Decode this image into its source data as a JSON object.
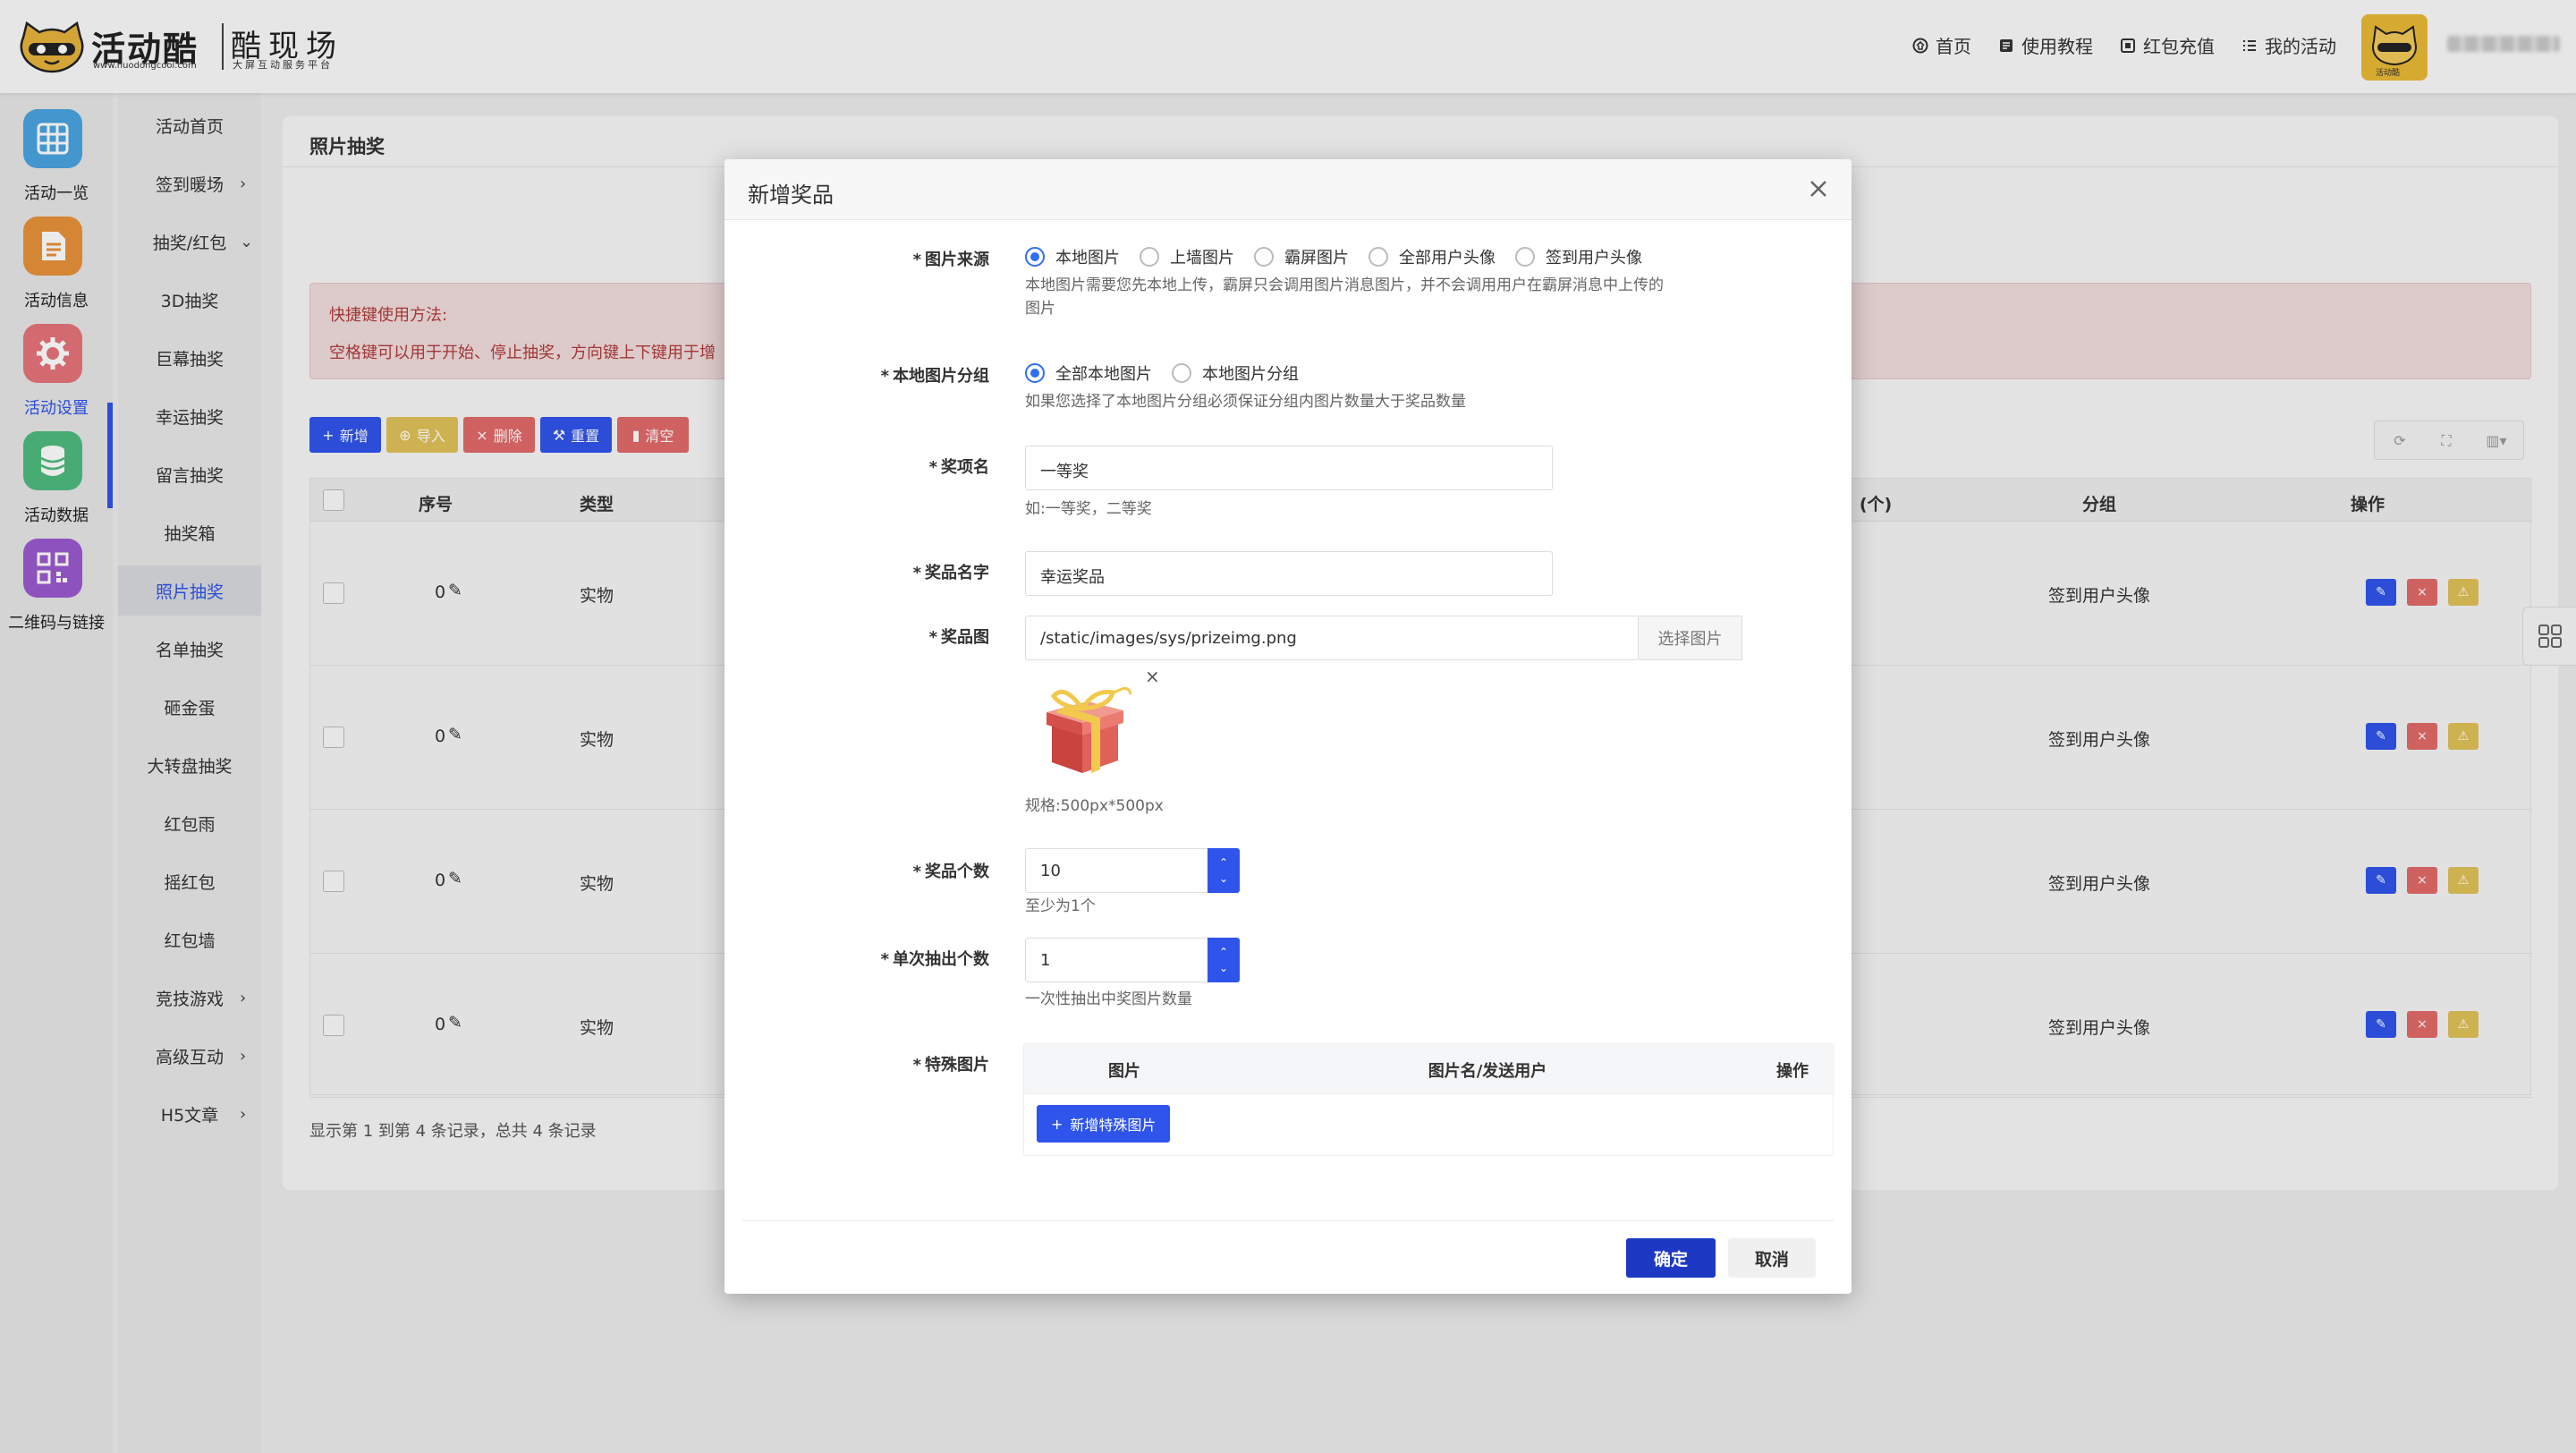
{
  "header": {
    "brand": "活动酷",
    "brand_url": "www.huodongcool.com",
    "brand_cool": "酷现场",
    "brand_tagline": "大屏互动服务平台",
    "nav": [
      {
        "label": "首页",
        "icon": "home-icon"
      },
      {
        "label": "使用教程",
        "icon": "book-icon"
      },
      {
        "label": "红包充值",
        "icon": "wallet-icon"
      },
      {
        "label": "我的活动",
        "icon": "list-icon"
      }
    ],
    "avatar_text": "活动酷"
  },
  "rail": {
    "items": [
      {
        "label": "活动一览",
        "icon": "grid-icon",
        "color": "#4aa3e0"
      },
      {
        "label": "活动信息",
        "icon": "document-icon",
        "color": "#e8923a"
      },
      {
        "label": "活动设置",
        "icon": "gear-icon",
        "color": "#e5737a"
      },
      {
        "label": "活动数据",
        "icon": "database-icon",
        "color": "#4fba7e"
      },
      {
        "label": "二维码与链接",
        "icon": "qrcode-icon",
        "color": "#9b59d0"
      }
    ]
  },
  "submenu": {
    "items": [
      {
        "label": "活动首页",
        "arrow": ""
      },
      {
        "label": "签到暖场",
        "arrow": "›"
      },
      {
        "label": "抽奖/红包",
        "arrow": "⌄"
      },
      {
        "label": "3D抽奖",
        "arrow": ""
      },
      {
        "label": "巨幕抽奖",
        "arrow": ""
      },
      {
        "label": "幸运抽奖",
        "arrow": ""
      },
      {
        "label": "留言抽奖",
        "arrow": ""
      },
      {
        "label": "抽奖箱",
        "arrow": ""
      },
      {
        "label": "照片抽奖",
        "arrow": ""
      },
      {
        "label": "名单抽奖",
        "arrow": ""
      },
      {
        "label": "砸金蛋",
        "arrow": ""
      },
      {
        "label": "大转盘抽奖",
        "arrow": ""
      },
      {
        "label": "红包雨",
        "arrow": ""
      },
      {
        "label": "摇红包",
        "arrow": ""
      },
      {
        "label": "红包墙",
        "arrow": ""
      },
      {
        "label": "竞技游戏",
        "arrow": "›"
      },
      {
        "label": "高级互动",
        "arrow": "›"
      },
      {
        "label": "H5文章",
        "arrow": "›"
      }
    ]
  },
  "page": {
    "title": "照片抽奖",
    "tip_title": "快捷键使用方法:",
    "tip_text": "空格键可以用于开始、停止抽奖，方向键上下键用于增",
    "toolbar": {
      "add": "新增",
      "import": "导入",
      "delete": "删除",
      "reset": "重置",
      "clear": "清空"
    },
    "colors": {
      "primary": "#2f54eb",
      "warning": "#e0c25a",
      "danger": "#e26a6a"
    },
    "table": {
      "headers": {
        "index": "序号",
        "type": "类型",
        "count": "(个)",
        "group": "分组",
        "actions": "操作"
      },
      "rows": [
        {
          "index": "0",
          "type": "实物",
          "group": "签到用户头像"
        },
        {
          "index": "0",
          "type": "实物",
          "group": "签到用户头像"
        },
        {
          "index": "0",
          "type": "实物",
          "group": "签到用户头像"
        },
        {
          "index": "0",
          "type": "实物",
          "group": "签到用户头像"
        }
      ]
    },
    "footer": "显示第 1 到第 4 条记录，总共 4 条记录"
  },
  "modal": {
    "title": "新增奖品",
    "source": {
      "label": "图片来源",
      "options": [
        "本地图片",
        "上墙图片",
        "霸屏图片",
        "全部用户头像",
        "签到用户头像"
      ],
      "selected": 0,
      "help1": "本地图片需要您先本地上传，霸屏只会调用图片消息图片，并不会调用用户在霸屏消息中上传的",
      "help2": "图片"
    },
    "group": {
      "label": "本地图片分组",
      "options": [
        "全部本地图片",
        "本地图片分组"
      ],
      "selected": 0,
      "help": "如果您选择了本地图片分组必须保证分组内图片数量大于奖品数量"
    },
    "prize_level": {
      "label": "奖项名",
      "value": "一等奖",
      "help": "如:一等奖，二等奖"
    },
    "prize_name": {
      "label": "奖品名字",
      "value": "幸运奖品"
    },
    "prize_image": {
      "label": "奖品图",
      "value": "/static/images/sys/prizeimg.png",
      "button": "选择图片",
      "remove": "×",
      "spec": "规格:500px*500px"
    },
    "prize_count": {
      "label": "奖品个数",
      "value": "10",
      "help": "至少为1个"
    },
    "draw_count": {
      "label": "单次抽出个数",
      "value": "1",
      "help": "一次性抽出中奖图片数量"
    },
    "special": {
      "label": "特殊图片",
      "headers": [
        "图片",
        "图片名/发送用户",
        "操作"
      ],
      "add_button": "新增特殊图片"
    },
    "ok": "确定",
    "cancel": "取消"
  }
}
